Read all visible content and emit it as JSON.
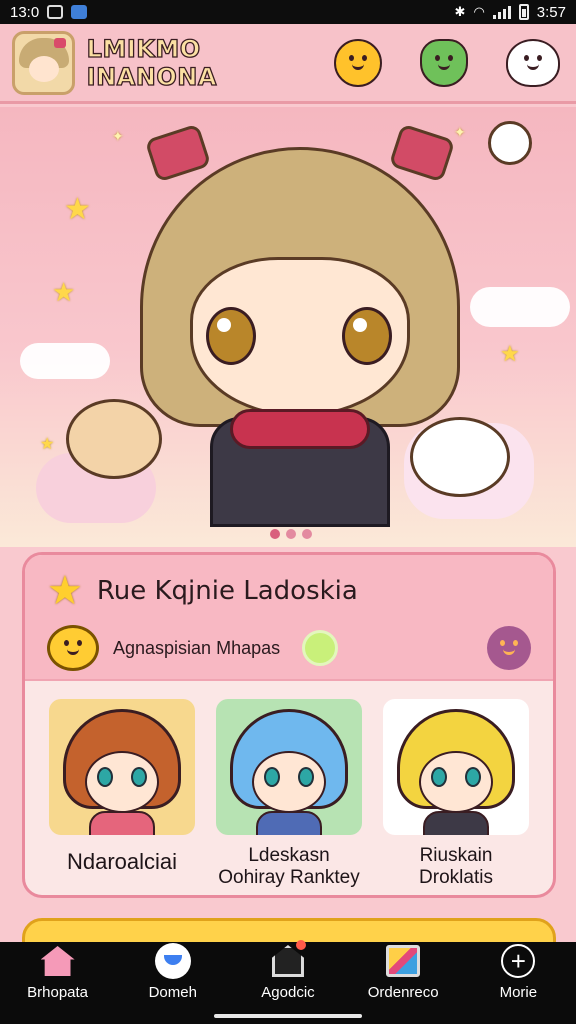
{
  "status_bar": {
    "time": "13:0",
    "clock": "3:57"
  },
  "header": {
    "title": "LMIKMO INANONA"
  },
  "featured": {
    "title": "Rue Kqjnie Ladoskia",
    "subtitle": "Agnaspisian Mhapas"
  },
  "characters": [
    {
      "name": "Ndaroalciai"
    },
    {
      "name": "Ldeskasn\nOohiray Ranktey"
    },
    {
      "name": "Riuskain\nDroklatis"
    }
  ],
  "nav": [
    {
      "label": "Brhopata",
      "icon": "home-icon"
    },
    {
      "label": "Domeh",
      "icon": "ghost-icon"
    },
    {
      "label": "Agodcic",
      "icon": "house-icon"
    },
    {
      "label": "Ordenreco",
      "icon": "frame-icon"
    },
    {
      "label": "Morie",
      "icon": "plus-icon"
    }
  ],
  "colors": {
    "accent_pink": "#f7c2c9",
    "nav_bg": "#0b0b0b",
    "star": "#ffd84a"
  }
}
